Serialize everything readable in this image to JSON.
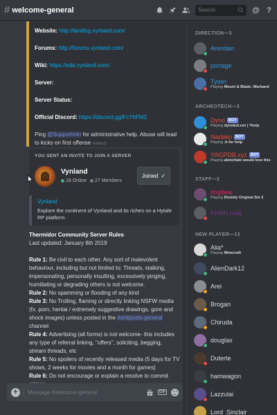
{
  "header": {
    "channel": "welcome-general",
    "search_placeholder": "Search",
    "icon_names": [
      "bell-icon",
      "pin-icon",
      "members-icon",
      "search-icon",
      "at-icon",
      "help-icon"
    ]
  },
  "embed": {
    "website_label": "Website:",
    "website_url": "http://landing.vynland.com/",
    "forums_label": "Forums:",
    "forums_url": "http://forums.vynland.com/",
    "wiki_label": "Wiki:",
    "wiki_url": "https://wiki.vynland.com/",
    "server_label": "Server:",
    "status_label": "Server Status:",
    "discord_label": "Official Discord:",
    "discord_url": "https://discord.gg/FcYhFMZ",
    "ping_prefix": "Ping ",
    "ping_mention": "@Supportmin",
    "ping_suffix": " for administrative help. Abuse will lead to kicks on first offense",
    "edited": "(edited)",
    "accent_color": "#d6a33a"
  },
  "invite": {
    "title": "YOU SENT AN INVITE TO JOIN A SERVER",
    "server_name": "Vynland",
    "online": "18 Online",
    "members": "27 Members",
    "button": "Joined"
  },
  "preview": {
    "title": "Vynland",
    "description": "Explore the continent of Vynland and its riches on a Hytale RP platform."
  },
  "rules": {
    "title": "Thermidor Community Server Rules",
    "updated": "Last updated: January 8th 2019",
    "r1_label": "Rule 1:",
    "r1_text": " Be civil to each other. Any sort of malevolent behaviour, including but not limited to: Threats, stalking, impersonating, personally insulting, excessively pinging, humiliating or degrading others is not welcome.",
    "r2_label": "Rule 2:",
    "r2_text": " No spamming or flooding of any kind",
    "r3_label": "Rule 3:",
    "r3_text": " No Trolling, flaming or directly linking NSFW media (fx. porn, hentai / extremely suggestive drawings, gore and shock images) unless posted in the ",
    "r3_channel": "#shitposts-general",
    "r3_tail": " channel",
    "r4_label": "Rule 4:",
    "r4_text": " Advertising (all forms) is not welcome- this includes any type of referral linking, \"offers\", soliciting, begging, stream threads, etc",
    "r5_label": "Rule 5:",
    "r5_text": " No spoilers of recently released media  (5 days for TV shows, 2 weeks for movies and a month for games)",
    "r6_label": "Rule 6:",
    "r6_text": " Do not encourage or explain a resolve to commit crimes"
  },
  "input": {
    "placeholder": "Message #welcome-general",
    "gif_label": "GIF"
  },
  "members": {
    "direction_header": "DIRECTION—3",
    "archeotech_header": "ARCHEOTECH—3",
    "staff_header": "STAFF—2",
    "newplayer_header": "NEW PLAYER—13",
    "bot_tag": "BOT",
    "playing": "Playing ",
    "list": [
      {
        "name": "Arendan",
        "color": "#3498db",
        "status": "online",
        "avatar": "#5b5e63",
        "activity": ""
      },
      {
        "name": "portage",
        "color": "#3498db",
        "status": "dnd",
        "avatar": "#7a7d82",
        "activity": ""
      },
      {
        "name": "Tywin",
        "color": "#3498db",
        "status": "dnd",
        "avatar": "#4a6fa5",
        "activity": "Mount & Blade: Warband"
      },
      {
        "name": "Dyno",
        "color": "#e74c3c",
        "status": "online",
        "avatar": "#2f8fd8",
        "activity": "dynobot.net | ?help",
        "bot": true
      },
      {
        "name": "Nadeko",
        "color": "#e74c3c",
        "status": "online",
        "avatar": "#e8e8e8",
        "activity": ".h for help",
        "bot": true
      },
      {
        "name": "YAGPDB.xyz",
        "color": "#e74c3c",
        "status": "online",
        "avatar": "#c0392b",
        "activity": "alonchalo would love this",
        "bot": true
      },
      {
        "name": "dogbew",
        "color": "#e91e63",
        "status": "online",
        "avatar": "#6d4c6f",
        "activity": "Divinity Original Sin 2"
      },
      {
        "name": "KHAN (val)",
        "color": "#71368a",
        "status": "dnd",
        "avatar": "#5a5d62",
        "activity": ""
      },
      {
        "name": "Alia*",
        "color": "#dcddde",
        "status": "online",
        "avatar": "#d8d8d8",
        "activity": "Minecraft"
      },
      {
        "name": "AlienDark12",
        "color": "#dcddde",
        "status": "online",
        "avatar": "#3f4a5e",
        "activity": ""
      },
      {
        "name": "Arei",
        "color": "#dcddde",
        "status": "idle",
        "avatar": "#8a8d92",
        "activity": ""
      },
      {
        "name": "Brogan",
        "color": "#dcddde",
        "status": "idle",
        "avatar": "#6a5a4a",
        "activity": ""
      },
      {
        "name": "Chiruda",
        "color": "#dcddde",
        "status": "idle",
        "avatar": "#5d6a7a",
        "activity": ""
      },
      {
        "name": "douglas",
        "color": "#dcddde",
        "status": "online",
        "avatar": "#8d6e9e",
        "activity": ""
      },
      {
        "name": "Duterte",
        "color": "#dcddde",
        "status": "dnd",
        "avatar": "#4b3a2f",
        "activity": ""
      },
      {
        "name": "hamwagon",
        "color": "#dcddde",
        "status": "online",
        "avatar": "#3a3d42",
        "activity": ""
      },
      {
        "name": "Lazzulai",
        "color": "#dcddde",
        "status": "dnd",
        "avatar": "#5a4f8a",
        "activity": ""
      },
      {
        "name": "Lord_Sinclair_",
        "color": "#dcddde",
        "status": "dnd",
        "avatar": "#c9a34a",
        "activity": ""
      }
    ]
  }
}
